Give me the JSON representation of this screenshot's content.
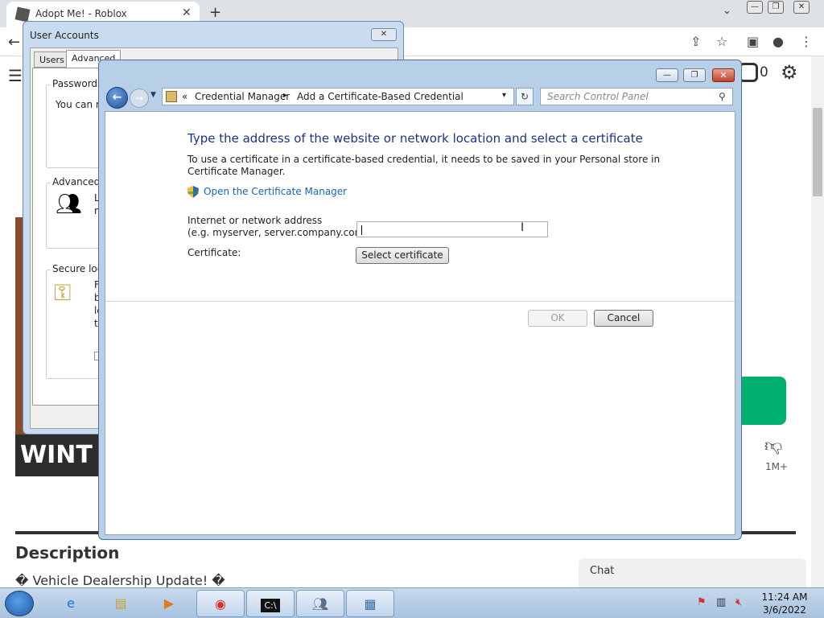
{
  "browser": {
    "tab_title": "Adopt Me! - Roblox",
    "new_tab": "+",
    "tab_close": "✕",
    "chevron": "⌄",
    "window_buttons": [
      "—",
      "❐",
      "✕"
    ]
  },
  "page": {
    "robux_count": "0",
    "game_banner_text": "WINT",
    "votes_label": "1M+",
    "description_title": "Description",
    "description_text": "� Vehicle Dealership Update! �",
    "chat_label": "Chat"
  },
  "user_accounts": {
    "title": "User Accounts",
    "close": "✕",
    "tabs": [
      "Users",
      "Advanced"
    ],
    "groups": {
      "passwords": "Passwords",
      "passwords_text": "You can m",
      "advanced": "Advanced u",
      "advanced_text": [
        "L",
        "m"
      ],
      "secure_logon": "Secure logo",
      "secure_text": [
        "F",
        "b",
        "lo",
        "th"
      ]
    }
  },
  "credential_manager": {
    "window_buttons": [
      "—",
      "❐",
      "✕"
    ],
    "breadcrumb": [
      "«",
      "Credential Manager",
      "▸",
      "Add a Certificate-Based Credential"
    ],
    "address_dropdown": "▾",
    "refresh": "↻",
    "search_placeholder": "Search Control Panel",
    "heading": "Type the address of the website or network location and select a certificate",
    "description": "To use a certificate in a certificate-based credential, it needs to be saved in your Personal store in Certificate Manager.",
    "cert_manager_link": "Open the Certificate Manager",
    "address_label_line1": "Internet or network address",
    "address_label_line2": "(e.g. myserver, server.company.com):",
    "address_value": "",
    "certificate_label": "Certificate:",
    "select_certificate": "Select certificate",
    "ok": "OK",
    "cancel": "Cancel"
  },
  "taskbar": {
    "time": "11:24 AM",
    "date": "3/6/2022"
  },
  "colors": {
    "heading": "#1e3287",
    "link": "#1464b4",
    "roblox_green": "#00b06f"
  }
}
